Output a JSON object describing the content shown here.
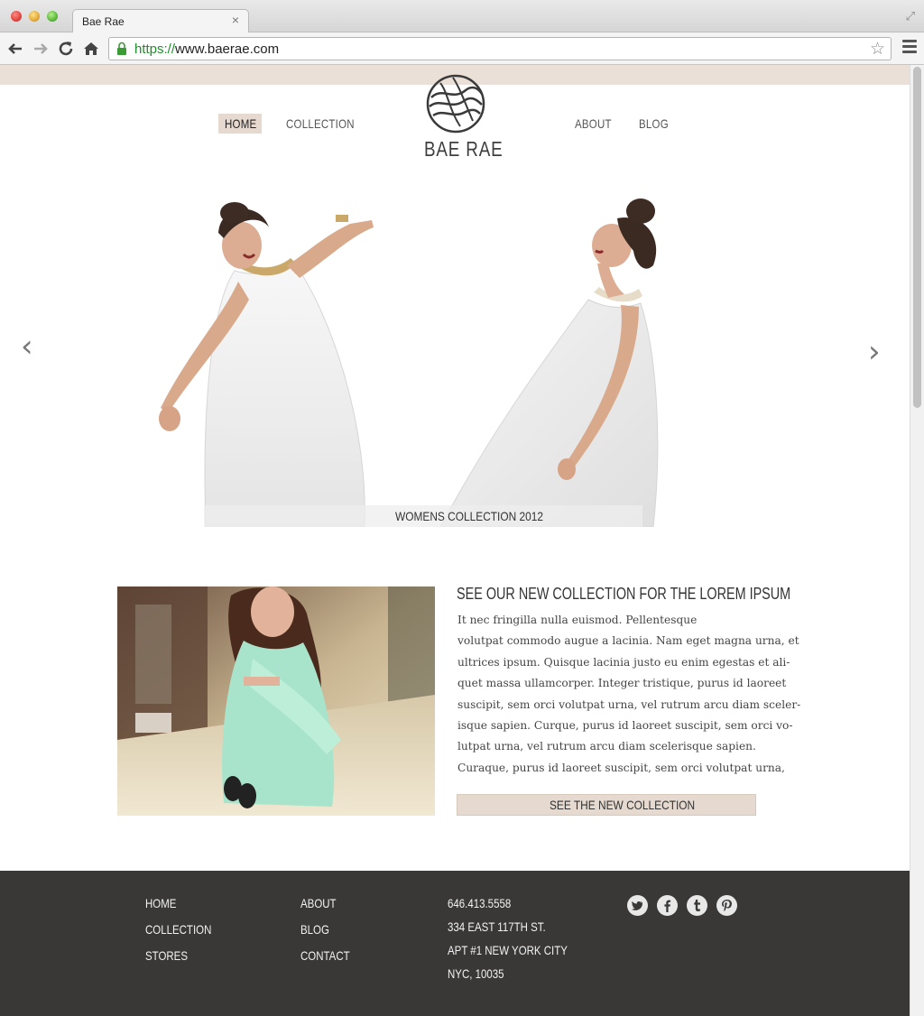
{
  "browser": {
    "tab_title": "Bae Rae",
    "tab_close": "×",
    "url_scheme": "https://",
    "url_rest": "www.baerae.com"
  },
  "nav": {
    "home": "HOME",
    "collection": "COLLECTION",
    "about": "ABOUT",
    "blog": "BLOG"
  },
  "brand": {
    "name": "BAE RAE"
  },
  "hero": {
    "caption": "WOMENS COLLECTION 2012",
    "prev": "‹",
    "next": "›"
  },
  "feature": {
    "title": "SEE OUR NEW COLLECTION FOR THE LOREM IPSUM",
    "lines": [
      "It nec fringilla nulla euismod. Pellentesque",
      "volutpat commodo augue a lacinia. Nam eget magna urna, et",
      "ultrices ipsum. Quisque lacinia justo eu enim egestas et ali-",
      "quet massa ullamcorper. Integer tristique, purus id laoreet",
      "suscipit, sem orci volutpat urna, vel rutrum arcu diam sceler-",
      "isque sapien. Curque, purus id laoreet suscipit, sem orci vo-",
      "lutpat urna, vel rutrum arcu diam scelerisque sapien.",
      "Curaque, purus id laoreet suscipit, sem orci volutpat urna,"
    ],
    "cta": "SEE THE NEW COLLECTION"
  },
  "footer": {
    "col1": [
      "HOME",
      "COLLECTION",
      "STORES"
    ],
    "col2": [
      "ABOUT",
      "BLOG",
      "CONTACT"
    ],
    "contact": [
      "646.413.5558",
      "334 EAST 117TH ST.",
      "APT #1 NEW YORK CITY",
      "NYC, 10035"
    ],
    "social_icons": [
      "twitter-icon",
      "facebook-icon",
      "tumblr-icon",
      "pinterest-icon"
    ]
  },
  "colors": {
    "accent": "#e6d9cf",
    "top_strip": "#ebe0d8",
    "footer_bg": "#393837"
  }
}
